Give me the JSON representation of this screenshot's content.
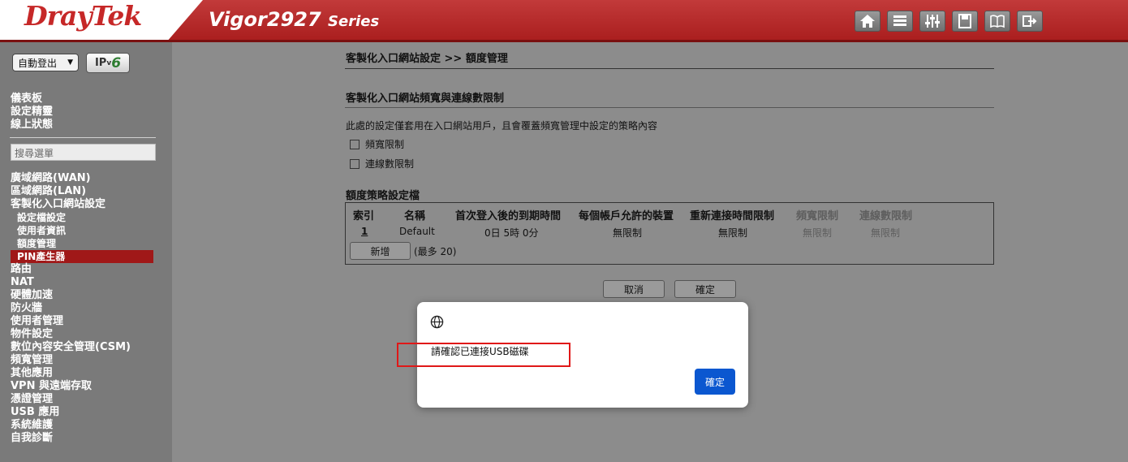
{
  "header": {
    "brand": "DrayTek",
    "model": "Vigor2927",
    "series": "Series",
    "icons": [
      "home-icon",
      "table-icon",
      "sliders-icon",
      "save-icon",
      "book-icon",
      "logout-icon"
    ]
  },
  "sidebar": {
    "logout_select": "自動登出",
    "ipv6_label_prefix": "IP",
    "ipv6_label_v": "v",
    "ipv6_label_six": "6",
    "top_links": [
      "儀表板",
      "設定精靈",
      "線上狀態"
    ],
    "search_placeholder": "搜尋選單",
    "menu_top": [
      "廣域網路(WAN)",
      "區域網路(LAN)",
      "客製化入口網站設定"
    ],
    "submenu": [
      "設定檔設定",
      "使用者資訊",
      "額度管理",
      "PIN產生器"
    ],
    "menu_bottom": [
      "路由",
      "NAT",
      "硬體加速",
      "防火牆",
      "使用者管理",
      "物件設定",
      "數位內容安全管理(CSM)",
      "頻寬管理",
      "其他應用",
      "VPN 與遠端存取",
      "憑證管理",
      "USB 應用",
      "系統維護",
      "自我診斷"
    ]
  },
  "main": {
    "breadcrumb": "客製化入口網站設定 >> 額度管理",
    "section_title": "客製化入口網站頻寬與連線數限制",
    "description": "此處的設定僅套用在入口網站用戶，且會覆蓋頻寬管理中設定的策略內容",
    "checkbox_bandwidth": "頻寬限制",
    "checkbox_sessions": "連線數限制",
    "profile_title": "額度策略設定檔",
    "table_headers": [
      "索引",
      "名稱",
      "首次登入後的到期時間",
      "每個帳戶允許的裝置",
      "重新連接時間限制",
      "頻寬限制",
      "連線數限制"
    ],
    "table_row": [
      "1",
      "Default",
      "0日 5時 0分",
      "無限制",
      "無限制",
      "無限制",
      "無限制"
    ],
    "add_button": "新增",
    "max_note": "(最多 20)",
    "cancel_button": "取消",
    "confirm_button": "確定"
  },
  "dialog": {
    "icon": "globe-icon",
    "message": "請確認已連接USB磁碟",
    "ok_button": "確定"
  },
  "colors": {
    "header_red": "#b52626",
    "active_menu": "#a01818",
    "dialog_button": "#0b57d0",
    "highlight_border": "#e01818"
  }
}
